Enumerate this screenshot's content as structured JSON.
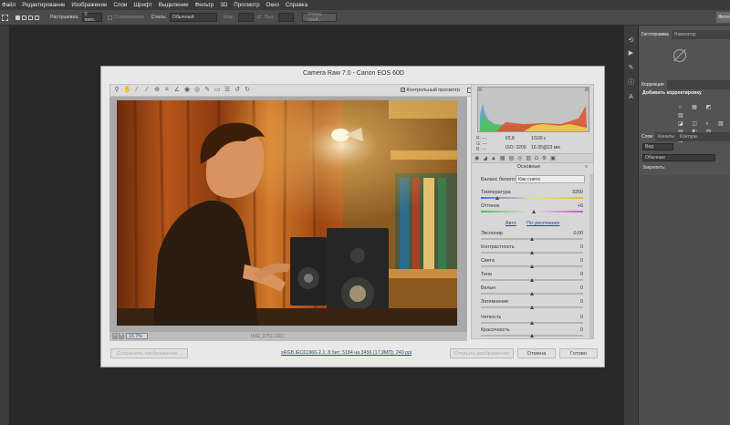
{
  "menubar": {
    "items": [
      "Файл",
      "Редактирование",
      "Изображение",
      "Слои",
      "Шрифт",
      "Выделение",
      "Фильтр",
      "3D",
      "Просмотр",
      "Окно",
      "Справка"
    ]
  },
  "options": {
    "feather_label": "Растушевка:",
    "feather_value": "0 пикс.",
    "antialias_label": "Сглаживание",
    "style_label": "Стиль:",
    "style_value": "Обычный",
    "width_label": "Шир.:",
    "height_label": "Выс.:",
    "refine_label": "Уточн. край..."
  },
  "right_panels": {
    "tab_histogram": "Гистограмма",
    "tab_navigator": "Навигатор",
    "tab_adjustments": "Коррекция",
    "add_adjustment": "Добавить корректировку",
    "tab_layers": "Слои",
    "tab_channels": "Каналы",
    "tab_paths": "Контуры",
    "kind_value": "Вид",
    "blend_value": "Обычные",
    "lock_label": "Закрепить:",
    "essentials": "Фото"
  },
  "dialog": {
    "title": "Camera Raw 7.0  -  Canon EOS 60D",
    "preview_label": "Контрольный просмотр",
    "zoom": "15.7%",
    "filename": "IMG_9751.CR2",
    "camera_info": {
      "r": "R:",
      "g": "G:",
      "b": "B:",
      "aperture": "f/2,8",
      "shutter": "1/100 с",
      "iso": "ISO: 3200",
      "focal": "16-35@23 мм",
      "dash": "---"
    },
    "section_title": "Основные",
    "wb_label": "Баланс белого:",
    "wb_value": "Как снято",
    "auto_link": "Авто",
    "default_link": "По умолчанию",
    "sliders": [
      {
        "label": "Температура",
        "value": "3250",
        "pos": 0.16
      },
      {
        "label": "Оттенок",
        "value": "+6",
        "pos": 0.52
      },
      {
        "label": "Экспонир",
        "value": "0,00",
        "pos": 0.5
      },
      {
        "label": "Контрастность",
        "value": "0",
        "pos": 0.5
      },
      {
        "label": "Света",
        "value": "0",
        "pos": 0.5
      },
      {
        "label": "Тени",
        "value": "0",
        "pos": 0.5
      },
      {
        "label": "Белые",
        "value": "0",
        "pos": 0.5
      },
      {
        "label": "Затемнение",
        "value": "0",
        "pos": 0.5
      },
      {
        "label": "Четкость",
        "value": "0",
        "pos": 0.5
      },
      {
        "label": "Красочность",
        "value": "0",
        "pos": 0.5
      }
    ],
    "save_button": "Сохранить изображение...",
    "workflow_link": "sRGB IEC61966-2.1; 8 бит; 5184 на 3456 (17,9МП); 240 ppi",
    "open_button": "Открыть изображение",
    "cancel_button": "Отмена",
    "done_button": "Готово"
  },
  "colors": {
    "accent": "#3b6fb6",
    "dialog_bg": "#e8e8e8",
    "ps_dark": "#282828",
    "ps_panel": "#535353"
  }
}
